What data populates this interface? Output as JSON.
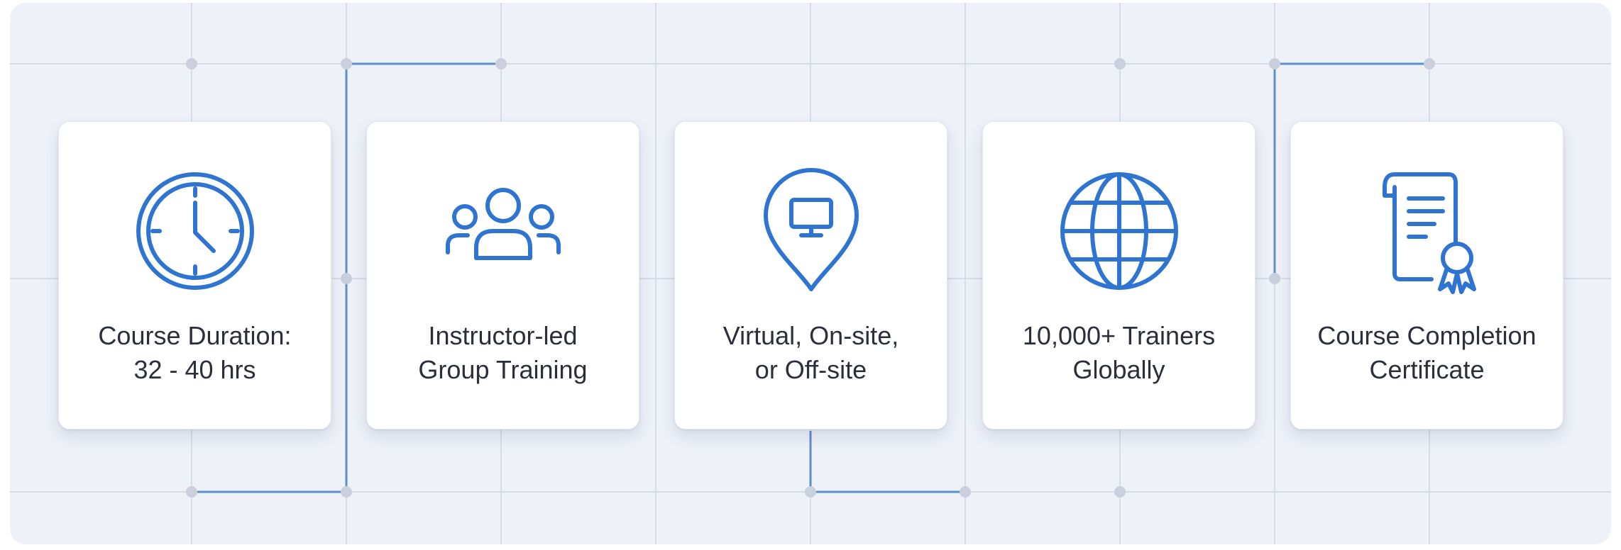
{
  "theme": {
    "accent": "#2f74d0",
    "panel_bg": "#eef1f8",
    "card_bg": "#ffffff",
    "text": "#2b2f3a"
  },
  "features": [
    {
      "icon": "clock-icon",
      "line1": "Course Duration:",
      "line2": "32 - 40 hrs"
    },
    {
      "icon": "group-icon",
      "line1": "Instructor-led",
      "line2": "Group Training"
    },
    {
      "icon": "location-pin-monitor-icon",
      "line1": "Virtual, On-site,",
      "line2": "or Off-site"
    },
    {
      "icon": "globe-icon",
      "line1": "10,000+ Trainers",
      "line2": "Globally"
    },
    {
      "icon": "certificate-icon",
      "line1": "Course Completion",
      "line2": "Certificate"
    }
  ]
}
